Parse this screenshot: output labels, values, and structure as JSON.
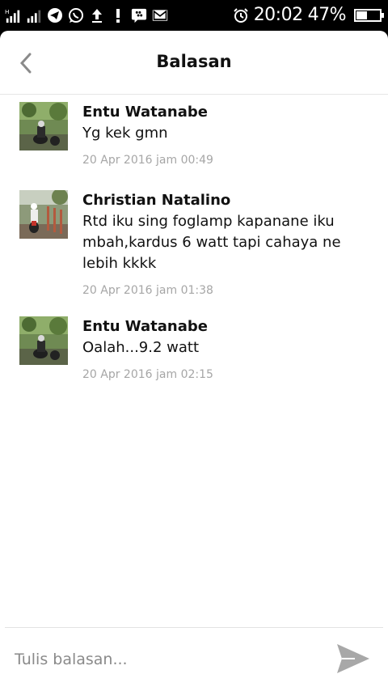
{
  "status_bar": {
    "time": "20:02",
    "battery_percent": "47%",
    "battery_level": 0.47,
    "icons": [
      "signal-icon",
      "signal-icon",
      "telegram-icon",
      "whatsapp-icon",
      "upload-icon",
      "alert-icon",
      "bbm-icon",
      "gmail-icon",
      "alarm-icon",
      "battery-icon"
    ]
  },
  "header": {
    "title": "Balasan",
    "back_icon": "chevron-left-icon"
  },
  "replies": [
    {
      "name": "Entu Watanabe",
      "text": "Yg kek gmn",
      "time": "20 Apr 2016 jam 00:49"
    },
    {
      "name": "Christian Natalino",
      "text": "Rtd iku sing foglamp kapanane iku mbah,kardus 6 watt tapi cahaya ne lebih kkkk",
      "time": "20 Apr 2016 jam 01:38"
    },
    {
      "name": "Entu Watanabe",
      "text": "Oalah...9.2 watt",
      "time": "20 Apr 2016 jam 02:15"
    }
  ],
  "composer": {
    "placeholder": "Tulis balasan...",
    "send_icon": "send-icon"
  },
  "colors": {
    "accent_gray": "#a6a6a6",
    "background": "#ffffff",
    "status_bar": "#000000"
  }
}
